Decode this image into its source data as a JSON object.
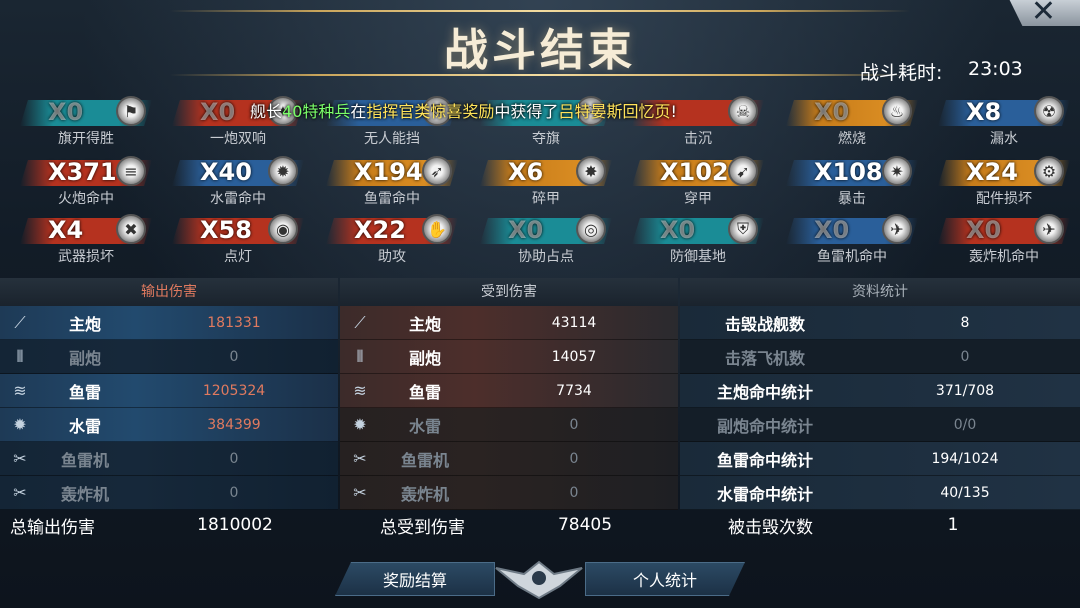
{
  "title": "战斗结束",
  "close_icon": "close-icon",
  "time": {
    "label": "战斗耗时:",
    "value": "23:03"
  },
  "banner": {
    "p1": "舰长",
    "name": "40特种兵",
    "p2": "在",
    "event": "指挥官类惊喜奖励",
    "p3": "中获得了",
    "item": "吕特晏斯回忆页",
    "p4": "!"
  },
  "medals": [
    [
      {
        "count": "X0",
        "name": "旗开得胜",
        "color": "teal",
        "icon": "flag-icon"
      },
      {
        "count": "X0",
        "name": "一炮双响",
        "color": "red",
        "icon": "double-shot-icon"
      },
      {
        "count": "",
        "name": "无人能挡",
        "color": "blue",
        "icon": "shield-icon"
      },
      {
        "count": "",
        "name": "夺旗",
        "color": "teal",
        "icon": "flag-capture-icon"
      },
      {
        "count": "",
        "name": "击沉",
        "color": "red",
        "icon": "skull-icon"
      },
      {
        "count": "X0",
        "name": "燃烧",
        "color": "orange",
        "icon": "fire-icon"
      },
      {
        "count": "X8",
        "name": "漏水",
        "color": "blue",
        "icon": "flood-icon"
      }
    ],
    [
      {
        "count": "X371",
        "name": "火炮命中",
        "color": "red",
        "icon": "cannon-icon"
      },
      {
        "count": "X40",
        "name": "水雷命中",
        "color": "blue",
        "icon": "mine-icon"
      },
      {
        "count": "X194",
        "name": "鱼雷命中",
        "color": "orange",
        "icon": "torpedo-icon"
      },
      {
        "count": "X6",
        "name": "碎甲",
        "color": "orange",
        "icon": "armor-break-icon"
      },
      {
        "count": "X102",
        "name": "穿甲",
        "color": "orange",
        "icon": "pierce-icon"
      },
      {
        "count": "X108",
        "name": "暴击",
        "color": "blue",
        "icon": "critical-icon"
      },
      {
        "count": "X24",
        "name": "配件损坏",
        "color": "orange",
        "icon": "gear-icon"
      }
    ],
    [
      {
        "count": "X4",
        "name": "武器损坏",
        "color": "red",
        "icon": "weapon-icon"
      },
      {
        "count": "X58",
        "name": "点灯",
        "color": "red",
        "icon": "spot-icon"
      },
      {
        "count": "X22",
        "name": "助攻",
        "color": "red",
        "icon": "hand-icon"
      },
      {
        "count": "X0",
        "name": "协助占点",
        "color": "teal",
        "icon": "target-icon"
      },
      {
        "count": "X0",
        "name": "防御基地",
        "color": "teal",
        "icon": "defense-icon"
      },
      {
        "count": "X0",
        "name": "鱼雷机命中",
        "color": "blue",
        "icon": "torpedo-plane-icon"
      },
      {
        "count": "X0",
        "name": "轰炸机命中",
        "color": "red",
        "icon": "bomber-icon"
      }
    ]
  ],
  "output": {
    "header": "输出伤害",
    "rows": [
      {
        "label": "主炮",
        "value": "181331"
      },
      {
        "label": "副炮",
        "value": "0"
      },
      {
        "label": "鱼雷",
        "value": "1205324"
      },
      {
        "label": "水雷",
        "value": "384399"
      },
      {
        "label": "鱼雷机",
        "value": "0"
      },
      {
        "label": "轰炸机",
        "value": "0"
      }
    ],
    "total_label": "总输出伤害",
    "total": "1810002"
  },
  "received": {
    "header": "受到伤害",
    "rows": [
      {
        "label": "主炮",
        "value": "43114"
      },
      {
        "label": "副炮",
        "value": "14057"
      },
      {
        "label": "鱼雷",
        "value": "7734"
      },
      {
        "label": "水雷",
        "value": "0"
      },
      {
        "label": "鱼雷机",
        "value": "0"
      },
      {
        "label": "轰炸机",
        "value": "0"
      }
    ],
    "total_label": "总受到伤害",
    "total": "78405"
  },
  "stats": {
    "header": "资料统计",
    "rows": [
      {
        "label": "击毁战舰数",
        "value": "8"
      },
      {
        "label": "击落飞机数",
        "value": "0"
      },
      {
        "label": "主炮命中统计",
        "value": "371/708"
      },
      {
        "label": "副炮命中统计",
        "value": "0/0"
      },
      {
        "label": "鱼雷命中统计",
        "value": "194/1024"
      },
      {
        "label": "水雷命中统计",
        "value": "40/135"
      }
    ],
    "total_label": "被击毁次数",
    "total": "1"
  },
  "buttons": {
    "reward": "奖励结算",
    "personal": "个人统计"
  }
}
